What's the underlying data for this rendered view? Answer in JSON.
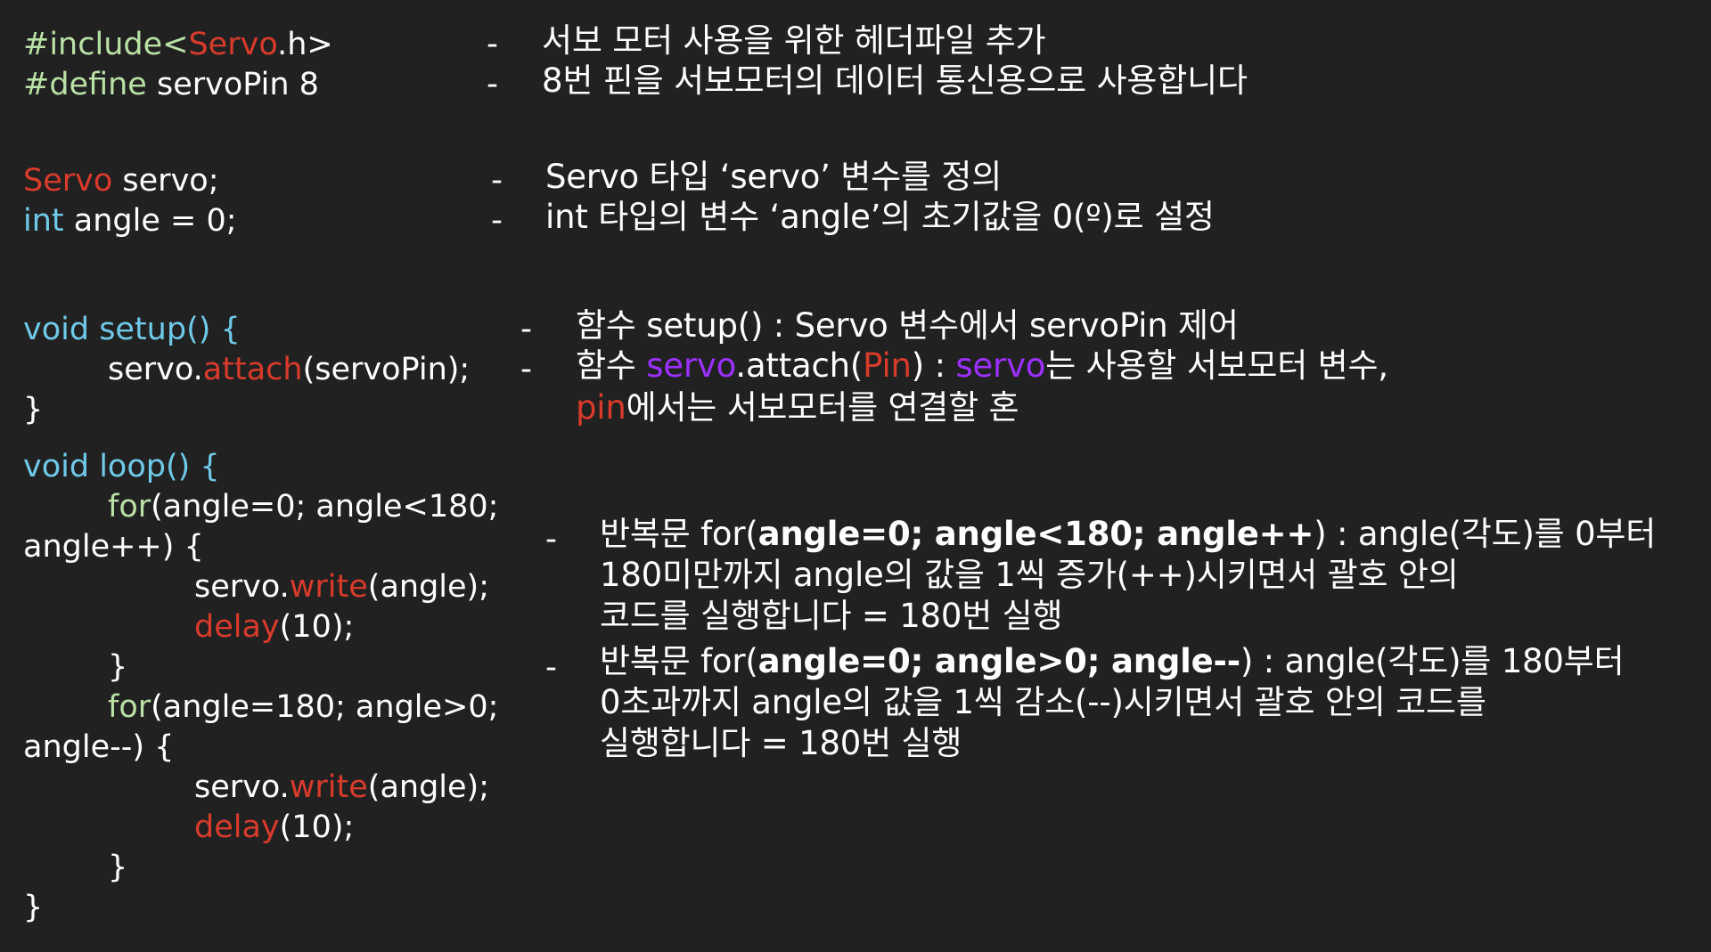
{
  "colors": {
    "background": "#212121",
    "text": "#ffffff",
    "preprocessor_green": "#b9e0a5",
    "keyword_red": "#d93b2b",
    "type_cyan": "#6fc9e8",
    "highlight_purple": "#9b30ff"
  },
  "code": {
    "include_kw": "#include<",
    "include_lib": "Servo",
    "include_end": ".h>",
    "define_kw": "#define",
    "define_rest": " servoPin 8",
    "servo_type": "Servo",
    "servo_decl": " servo;",
    "int_type": "int",
    "angle_decl": " angle = 0;",
    "setup_sig": "void setup() {",
    "attach_obj": "servo.",
    "attach_fn": "attach",
    "attach_args": "(servoPin);",
    "close_brace": "}",
    "loop_sig": "void loop() {",
    "for_kw": "for",
    "for1_cond": "(angle=0; angle<180;",
    "for1_cont": "angle++) {",
    "write_obj": "servo.",
    "write_fn": "write",
    "write_args": "(angle);",
    "delay_fn": "delay",
    "delay_args": "(10);",
    "inner_close": "}",
    "for2_cond": "(angle=180; angle>0;",
    "for2_cont": "angle--) {"
  },
  "notes": {
    "dash": "-",
    "include_desc": "서보 모터 사용을 위한 헤더파일 추가",
    "define_desc": "8번 핀을 서보모터의 데이터 통신용으로 사용합니다",
    "servo_desc": "Servo 타입 ‘servo’ 변수를 정의",
    "angle_desc": "int 타입의 변수 ‘angle’의 초기값을 0(º)로 설정",
    "setup_desc": "함수 setup() : Servo 변수에서 servoPin 제어",
    "attach_a": "함수 ",
    "attach_servo": "servo",
    "attach_b": ".attach(",
    "attach_pin": "Pin",
    "attach_c": ") : ",
    "attach_servo2": "servo",
    "attach_d": "는 사용할 서보모터 변수,",
    "attach_pin2": "pin",
    "attach_e": "에서는 서보모터를 연결할 혼",
    "loop1_a": "반복문 for(",
    "loop1_b": "angle=0; angle<180; angle++",
    "loop1_c": ") : angle(각도)를 0부터",
    "loop1_line2": "180미만까지 angle의 값을 1씩 증가(++)시키면서 괄호 안의",
    "loop1_line3": "코드를 실행합니다 = 180번 실행",
    "loop2_a": "반복문 for(",
    "loop2_b": "angle=0; angle>0; angle--",
    "loop2_c": ") : angle(각도)를 180부터",
    "loop2_line2": "0초과까지 angle의 값을 1씩 감소(--)시키면서 괄호 안의 코드를",
    "loop2_line3": "실행합니다 = 180번 실행"
  }
}
